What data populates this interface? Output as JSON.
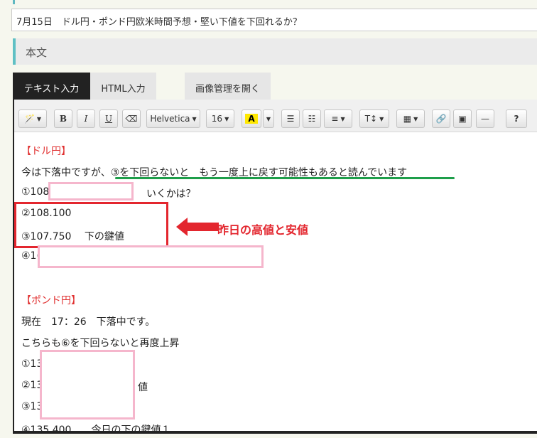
{
  "post_title": "7月15日　ドル円・ポンド円欧米時間予想・堅い下値を下回れるか？",
  "section_title": "本文",
  "tabs": {
    "text_input": "テキスト入力",
    "html_input": "HTML入力",
    "image_manager": "画像管理を開く"
  },
  "toolbar": {
    "magic": "🪄",
    "bold": "B",
    "italic": "I",
    "underline": "U",
    "eraser": "⌫",
    "font_family": "Helvetica",
    "font_size": "16",
    "font_color": "A",
    "ul": "☰",
    "ol": "☷",
    "align": "≡",
    "text_height": "T↕",
    "table": "▦",
    "link": "🔗",
    "image": "▣",
    "hr": "—",
    "help": "?",
    "caret": "▼"
  },
  "content": {
    "usd_heading": "【ドル円】",
    "usd_line1": "今は下落中ですが、③を下回らないと　もう一度上に戻す可能性もあると読んでいます",
    "usd_line2_pre": "①108",
    "usd_line2_post": "いくかは？",
    "usd_line3": "②108.100",
    "usd_line4": "③107.750　 下の鍵値",
    "usd_line5": "④1(",
    "annotation": "昨日の高値と安値",
    "gbp_heading": "【ポンド円】",
    "gbp_line1": "現在　17：26　下落中です。",
    "gbp_line2": "こちらも⑥を下回らないと再度上昇",
    "gbp_line3": "①13",
    "gbp_line4_pre": "②13",
    "gbp_line4_post": "値",
    "gbp_line5": "③13",
    "gbp_line6": "④135.400　　今日の下の鍵値１"
  },
  "colors": {
    "accent_teal": "#5fc0c4",
    "red": "#e3262e",
    "green_underline": "#1e9e4a",
    "pink_mask": "#f5b6cc"
  }
}
